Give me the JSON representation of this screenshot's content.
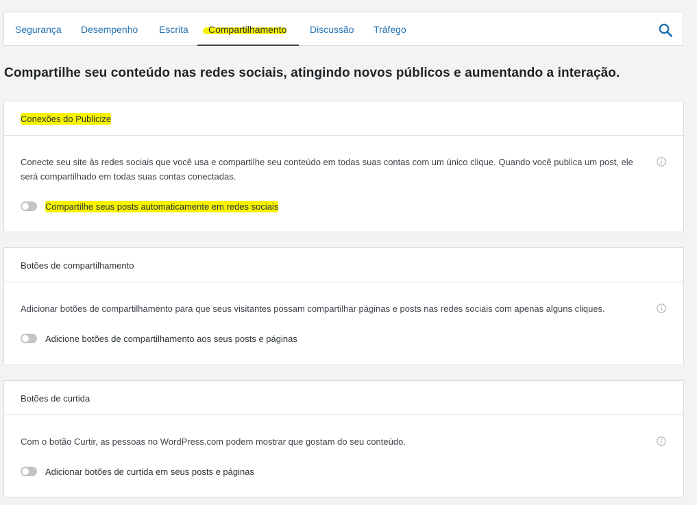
{
  "tabs": [
    {
      "label": "Segurança",
      "active": false
    },
    {
      "label": "Desempenho",
      "active": false
    },
    {
      "label": "Escrita",
      "active": false
    },
    {
      "label": "Compartilhamento",
      "active": true
    },
    {
      "label": "Discussão",
      "active": false
    },
    {
      "label": "Tráfego",
      "active": false
    }
  ],
  "search": {
    "icon": "search-icon"
  },
  "headline": "Compartilhe seu conteúdo nas redes sociais, atingindo novos públicos e aumentando a interação.",
  "cards": [
    {
      "title": "Conexões do Publicize",
      "description": "Conecte seu site às redes sociais que você usa e compartilhe seu conteúdo em todas suas contas com um único clique. Quando você publica um post, ele será compartilhado em todas suas contas conectadas.",
      "toggle_label": "Compartilhe seus posts automaticamente em redes sociais",
      "toggle_on": false
    },
    {
      "title": "Botões de compartilhamento",
      "description": "Adicionar botões de compartilhamento para que seus visitantes possam compartilhar páginas e posts nas redes sociais com apenas alguns cliques.",
      "toggle_label": "Adicione botões de compartilhamento aos seus posts e páginas",
      "toggle_on": false
    },
    {
      "title": "Botões de curtida",
      "description": "Com o botão Curtir, as pessoas no WordPress.com podem mostrar que gostam do seu conteúdo.",
      "toggle_label": "Adicionar botões de curtida em seus posts e páginas",
      "toggle_on": false
    }
  ],
  "colors": {
    "link": "#2271b1",
    "highlight": "#f7f300",
    "toggle_off": "#c3c4c7",
    "background": "#f3f3f3"
  }
}
